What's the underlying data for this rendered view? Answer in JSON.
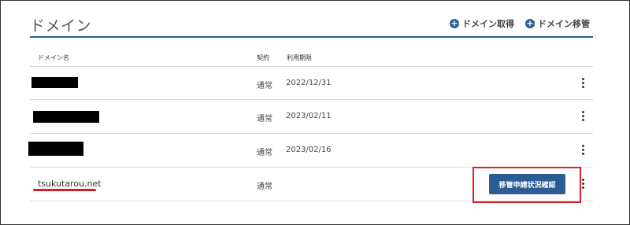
{
  "header": {
    "title": "ドメイン",
    "actions": [
      {
        "label": "ドメイン取得",
        "icon": "plus-circle-icon"
      },
      {
        "label": "ドメイン移管",
        "icon": "plus-circle-icon"
      }
    ]
  },
  "columns": {
    "domain": "ドメイン名",
    "contract": "契約",
    "expiry": "利用期限"
  },
  "rows": [
    {
      "domain": "",
      "redacted": true,
      "contract": "通常",
      "expiry": "2022/12/31"
    },
    {
      "domain": "",
      "redacted": true,
      "contract": "通常",
      "expiry": "2023/02/11"
    },
    {
      "domain": "",
      "redacted": true,
      "contract": "通常",
      "expiry": "2023/02/16"
    },
    {
      "domain": "tsukutarou.net",
      "redacted": false,
      "contract": "通常",
      "expiry": "",
      "action_button": "移管申請状況確認"
    }
  ],
  "colors": {
    "accent": "#2f5d8f",
    "button": "#2b5d94",
    "highlight": "#e0202a"
  }
}
